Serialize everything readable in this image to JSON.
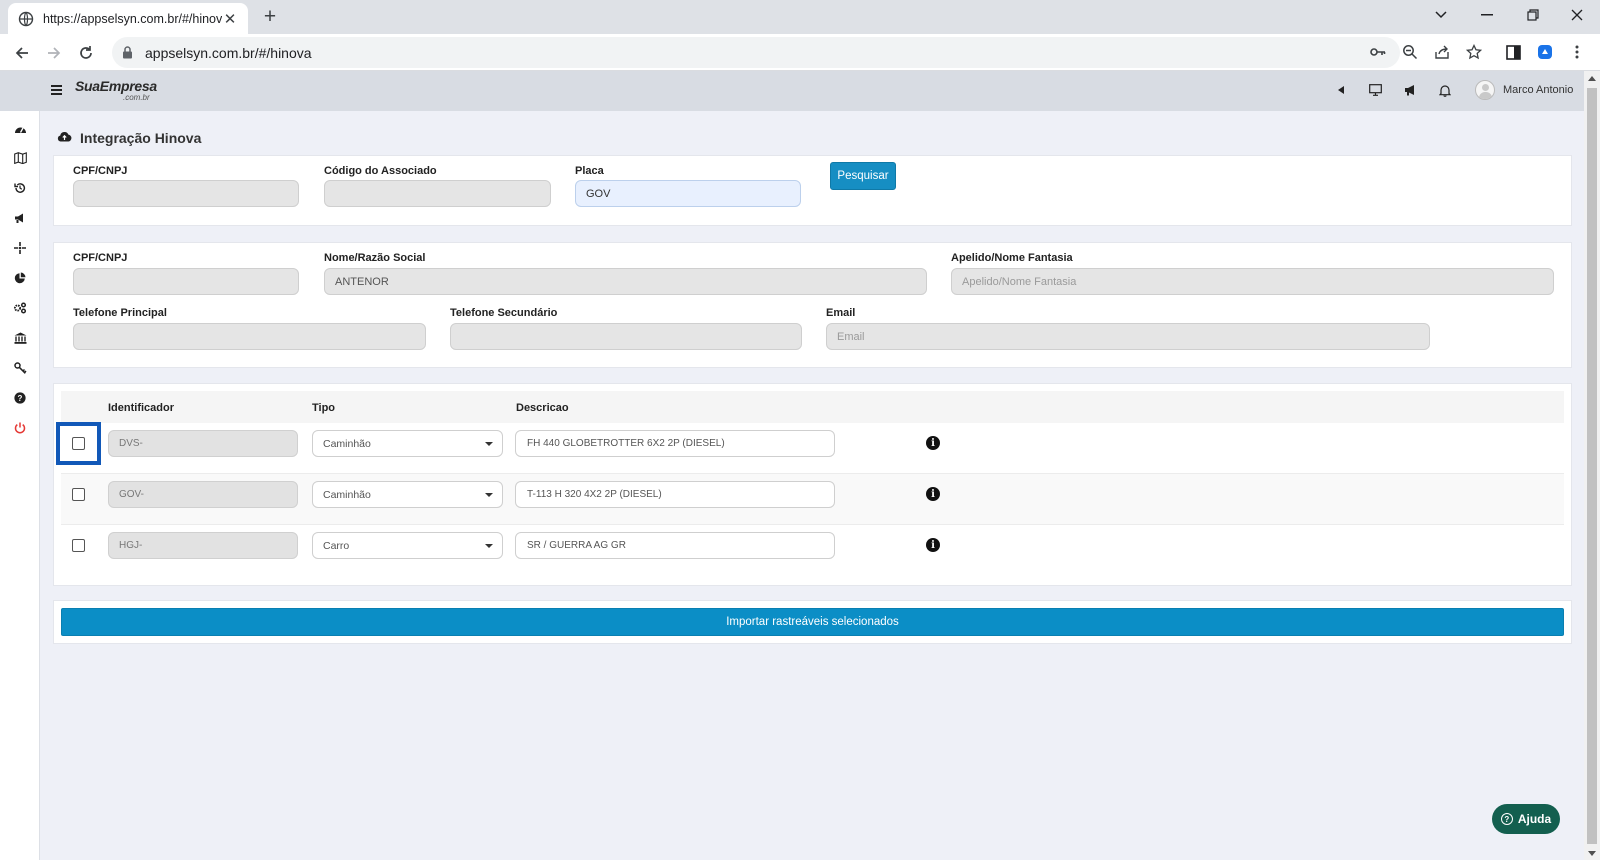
{
  "browser": {
    "tab_title": "https://appselsyn.com.br/#/hinova",
    "url": "appselsyn.com.br/#/hinova"
  },
  "app": {
    "logo_text": "SuaEmpresa",
    "logo_sub": ".com.br",
    "user_name": "Marco Antonio"
  },
  "page": {
    "title": "Integração Hinova"
  },
  "search": {
    "cpf_label": "CPF/CNPJ",
    "cpf_value": "",
    "codigo_label": "Código do Associado",
    "codigo_value": "",
    "placa_label": "Placa",
    "placa_value": "GOV",
    "search_button": "Pesquisar"
  },
  "details": {
    "cpf_label": "CPF/CNPJ",
    "cpf_value": "",
    "nome_label": "Nome/Razão Social",
    "nome_value": "ANTENOR",
    "apelido_label": "Apelido/Nome Fantasia",
    "apelido_placeholder": "Apelido/Nome Fantasia",
    "tel1_label": "Telefone Principal",
    "tel1_value": "",
    "tel2_label": "Telefone Secundário",
    "tel2_value": "",
    "email_label": "Email",
    "email_placeholder": "Email"
  },
  "vehicles": {
    "headers": {
      "identificador": "Identificador",
      "tipo": "Tipo",
      "descricao": "Descricao"
    },
    "rows": [
      {
        "id": "DVS-",
        "tipo": "Caminhão",
        "descricao": "FH 440 GLOBETROTTER 6X2 2P (DIESEL)",
        "checked": false
      },
      {
        "id": "GOV-",
        "tipo": "Caminhão",
        "descricao": "T-113 H 320 4X2 2P (DIESEL)",
        "checked": false
      },
      {
        "id": "HGJ-",
        "tipo": "Carro",
        "descricao": "SR / GUERRA AG GR",
        "checked": false
      }
    ]
  },
  "actions": {
    "import_button": "Importar rastreáveis selecionados",
    "help_button": "Ajuda"
  },
  "colors": {
    "primary": "#0b8ec6",
    "help": "#135f4f",
    "focus": "#1158b8"
  }
}
